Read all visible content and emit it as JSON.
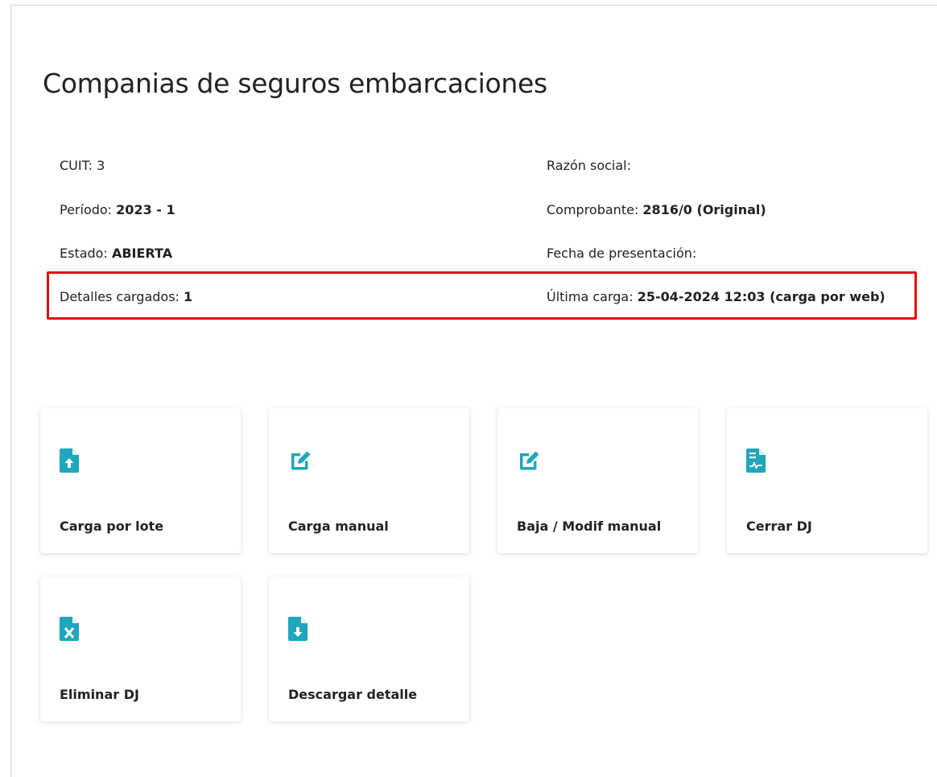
{
  "page": {
    "title": "Companias de seguros embarcaciones"
  },
  "info": {
    "cuit_label": "CUIT:",
    "cuit_value": "3",
    "razon_social_label": "Razón social:",
    "razon_social_value": "",
    "periodo_label": "Período:",
    "periodo_value": "2023 - 1",
    "comprobante_label": "Comprobante:",
    "comprobante_value": "2816/0 (Original)",
    "estado_label": "Estado:",
    "estado_value": "ABIERTA",
    "fecha_presentacion_label": "Fecha de presentación:",
    "fecha_presentacion_value": "",
    "detalles_label": "Detalles cargados:",
    "detalles_value": "1",
    "ultima_carga_label": "Última carga:",
    "ultima_carga_value": "25-04-2024 12:03 (carga por web)"
  },
  "colors": {
    "accent": "#1ea7bd",
    "highlight": "#e00b0b"
  },
  "actions": [
    {
      "label": "Carga por lote",
      "icon": "file-upload-icon"
    },
    {
      "label": "Carga manual",
      "icon": "edit-icon"
    },
    {
      "label": "Baja / Modif manual",
      "icon": "edit-icon"
    },
    {
      "label": "Cerrar DJ",
      "icon": "file-signature-icon"
    },
    {
      "label": "Eliminar DJ",
      "icon": "file-excel-icon"
    },
    {
      "label": "Descargar detalle",
      "icon": "file-download-icon"
    }
  ]
}
